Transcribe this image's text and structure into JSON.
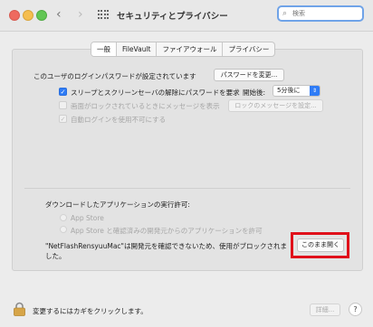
{
  "window": {
    "title": "セキュリティとプライバシー",
    "search_placeholder": "検索",
    "nav_back": "‹",
    "nav_forward": "›"
  },
  "tabs": [
    {
      "label": "一般",
      "selected": true
    },
    {
      "label": "FileVault",
      "selected": false
    },
    {
      "label": "ファイアウォール",
      "selected": false
    },
    {
      "label": "プライバシー",
      "selected": false
    }
  ],
  "login": {
    "password_text": "このユーザのログインパスワードが設定されています",
    "change_password_button": "パスワードを変更...",
    "require_password_label": "スリープとスクリーンセーバの解除にパスワードを要求",
    "require_password_checked": true,
    "after_label": "開始後:",
    "after_value": "5分後に",
    "show_message_label": "画面がロックされているときにメッセージを表示",
    "show_message_checked": false,
    "set_message_button": "ロックのメッセージを設定...",
    "disable_auto_login_label": "自動ログインを使用不可にする",
    "disable_auto_login_checked": true
  },
  "downloads": {
    "heading": "ダウンロードしたアプリケーションの実行許可:",
    "option_app_store": "App Store",
    "option_app_store_devs": "App Store と確認済みの開発元からのアプリケーションを許可",
    "blocked_message_line1": "\"NetFlashRensyuuMac\"は開発元を確認できないため、使用がブロックされま",
    "blocked_message_line2": "した。",
    "open_anyway_button": "このまま開く"
  },
  "footer": {
    "lock_text": "変更するにはカギをクリックします。",
    "advanced_button": "詳細...",
    "help_button": "?"
  },
  "colors": {
    "accent": "#2f7cf6",
    "highlight": "#e0101a"
  }
}
